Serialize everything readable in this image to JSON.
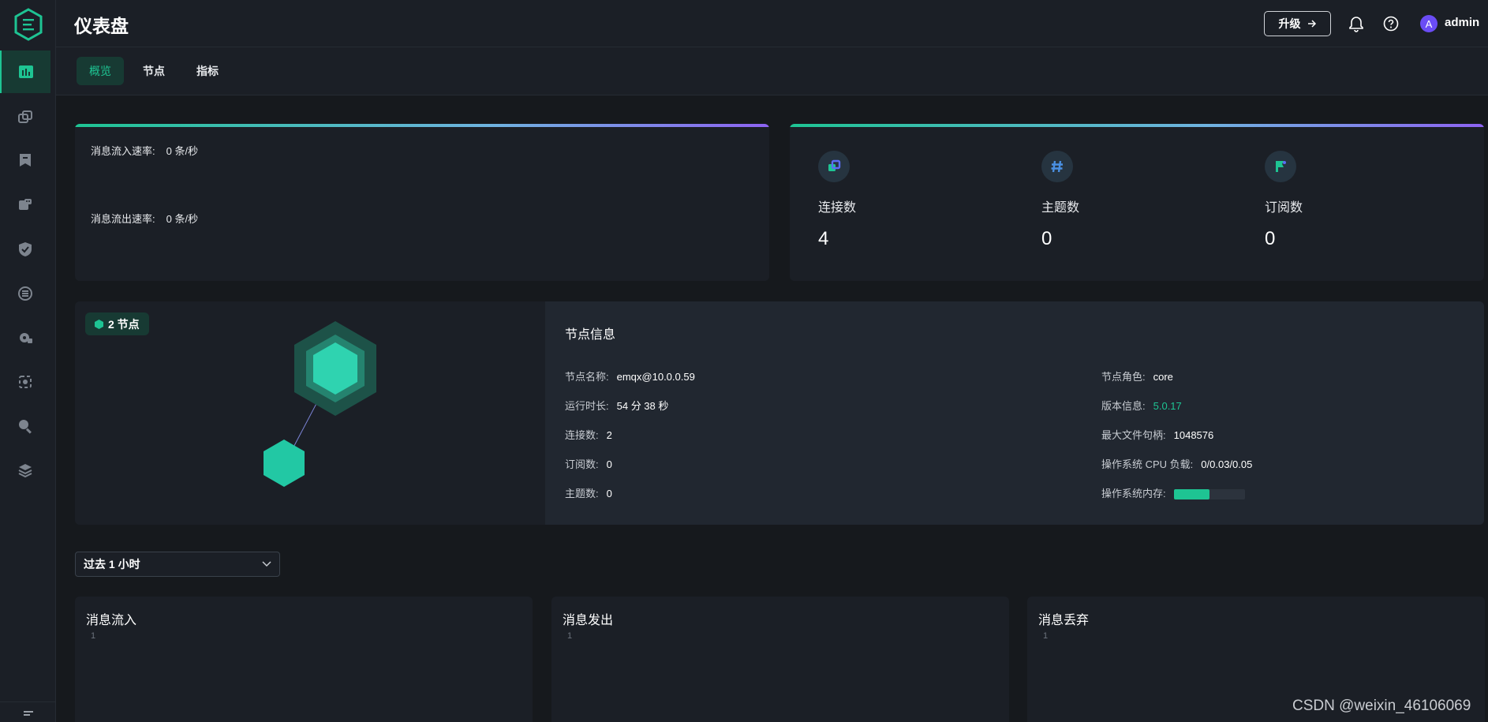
{
  "header": {
    "title": "仪表盘",
    "upgrade_label": "升级",
    "username": "admin",
    "avatar_letter": "A"
  },
  "sidebar": {
    "items": [
      {
        "icon": "dashboard-icon",
        "active": true
      },
      {
        "icon": "connections-icon"
      },
      {
        "icon": "subscriptions-icon"
      },
      {
        "icon": "retained-icon"
      },
      {
        "icon": "security-icon"
      },
      {
        "icon": "integration-icon"
      },
      {
        "icon": "management-icon"
      },
      {
        "icon": "diagnose-icon"
      },
      {
        "icon": "topic-search-icon"
      },
      {
        "icon": "storage-icon"
      }
    ],
    "collapse_icon": "collapse-icon"
  },
  "tabs": [
    {
      "label": "概览",
      "active": true
    },
    {
      "label": "节点"
    },
    {
      "label": "指标"
    }
  ],
  "rates": {
    "in_label": "消息流入速率:",
    "in_value": "0 条/秒",
    "out_label": "消息流出速率:",
    "out_value": "0 条/秒"
  },
  "stats": [
    {
      "label": "连接数",
      "value": "4",
      "icon": "connection-icon"
    },
    {
      "label": "主题数",
      "value": "0",
      "icon": "hash-icon"
    },
    {
      "label": "订阅数",
      "value": "0",
      "icon": "flag-icon"
    }
  ],
  "nodes": {
    "badge": "2 节点"
  },
  "node_info": {
    "title": "节点信息",
    "left": [
      {
        "label": "节点名称:",
        "value": "emqx@10.0.0.59"
      },
      {
        "label": "运行时长:",
        "value": "54 分 38 秒"
      },
      {
        "label": "连接数:",
        "value": "2"
      },
      {
        "label": "订阅数:",
        "value": "0"
      },
      {
        "label": "主题数:",
        "value": "0"
      }
    ],
    "right": [
      {
        "label": "节点角色:",
        "value": "core"
      },
      {
        "label": "版本信息:",
        "value": "5.0.17"
      },
      {
        "label": "最大文件句柄:",
        "value": "1048576"
      },
      {
        "label": "操作系统 CPU 负载:",
        "value": "0/0.03/0.05"
      },
      {
        "label": "操作系统内存:",
        "memory_used_fraction": 0.5
      }
    ]
  },
  "time_range": {
    "selected": "过去 1 小时"
  },
  "charts": [
    {
      "title": "消息流入",
      "tick": "1"
    },
    {
      "title": "消息发出",
      "tick": "1"
    },
    {
      "title": "消息丢弃",
      "tick": "1"
    }
  ],
  "watermark": "CSDN @weixin_46106069",
  "colors": {
    "accent": "#1ec493",
    "background": "#16191d",
    "panel": "#1b1f26",
    "avatar": "#6a4cf5"
  }
}
